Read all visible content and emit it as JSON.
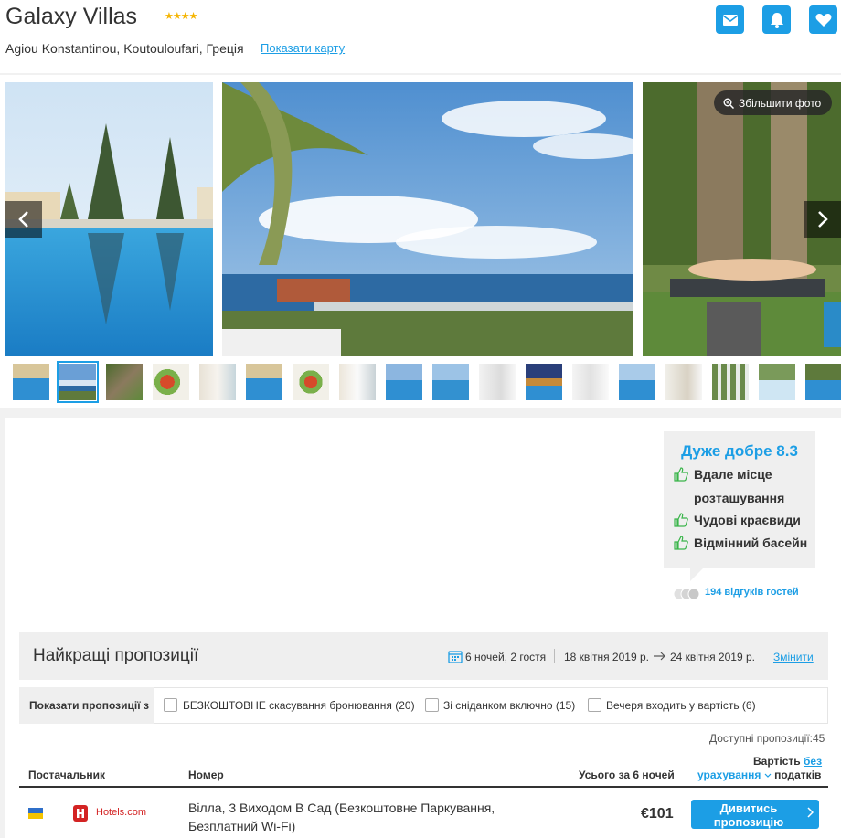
{
  "hotel": {
    "name": "Galaxy Villas",
    "stars": "★★★★",
    "star_rating": 4,
    "address": "Agiou Konstantinou, Koutouloufari, Греція",
    "map_link": "Показати карту"
  },
  "header_actions": [
    "mail-icon",
    "bell-icon",
    "heart-icon"
  ],
  "gallery": {
    "zoom_label": "Збільшити фото",
    "thumbnail_count": 18,
    "selected_thumbnail": 2
  },
  "rating": {
    "score_label": "Дуже добре 8.3",
    "pros": [
      "Вдале місце",
      "розташування",
      "Чудові краєвиди",
      "Відмінний басейн"
    ],
    "reviews_label": "194 відгуків гостей"
  },
  "offers": {
    "title": "Найкращі пропозиції",
    "guests": "6 ночей, 2 гостя",
    "checkin": "18 квітня 2019 р.",
    "checkout": "24 квітня 2019 р.",
    "change_label": "Змінити",
    "filter_label": "Показати пропозиції з",
    "filters": [
      "БЕЗКОШТОВНЕ скасування бронювання (20)",
      "Зі сніданком включно (15)",
      "Вечеря входить у вартість (6)"
    ],
    "available_label": "Доступні пропозиції:45"
  },
  "table": {
    "col_provider": "Постачальник",
    "col_room": "Номер",
    "col_total": "Усього за 6 ночей",
    "col_cost_prefix": "Вартість",
    "col_cost_link1": "без",
    "col_cost_link2": "урахування",
    "col_cost_suffix": "податків",
    "rows": [
      {
        "provider": "Hotels.com",
        "room": "Вілла, 3 Виходом В Сад (Безкоштовне Паркування, Безплатний Wi-Fi)",
        "price": "€101",
        "cta": "Дивитись пропозицію"
      }
    ]
  },
  "colors": {
    "accent": "#1c9ee5",
    "star": "#f5b400",
    "pro_icon": "#3ab54a",
    "provider": "#d32323"
  }
}
